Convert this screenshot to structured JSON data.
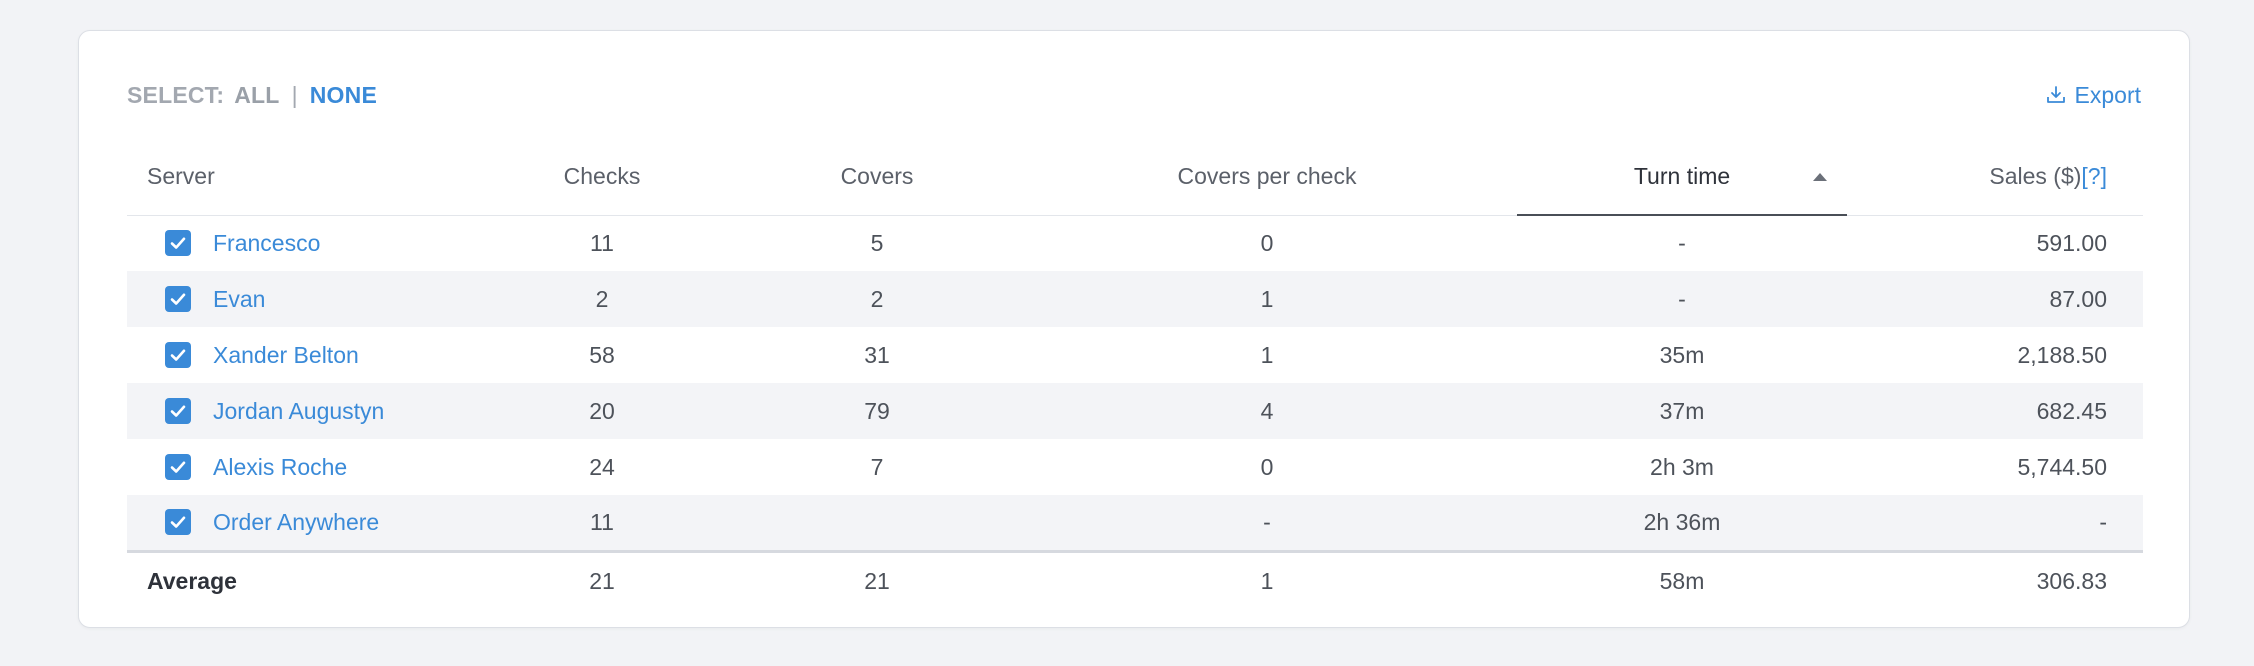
{
  "toolbar": {
    "select_label": "SELECT:",
    "all_label": "ALL",
    "separator": "|",
    "none_label": "NONE",
    "export_label": "Export",
    "export_icon": "download-icon"
  },
  "table": {
    "headers": {
      "server": "Server",
      "checks": "Checks",
      "covers": "Covers",
      "covers_per_check": "Covers per check",
      "turn_time": "Turn time",
      "sales": "Sales ($)",
      "sales_help": "[?]"
    },
    "sort": {
      "column": "turn_time",
      "direction": "ascending"
    },
    "rows": [
      {
        "server": "Francesco",
        "checked": true,
        "checks": "11",
        "covers": "5",
        "covers_per_check": "0",
        "turn_time": "-",
        "sales": "591.00"
      },
      {
        "server": "Evan",
        "checked": true,
        "checks": "2",
        "covers": "2",
        "covers_per_check": "1",
        "turn_time": "-",
        "sales": "87.00"
      },
      {
        "server": "Xander Belton",
        "checked": true,
        "checks": "58",
        "covers": "31",
        "covers_per_check": "1",
        "turn_time": "35m",
        "sales": "2,188.50"
      },
      {
        "server": "Jordan Augustyn",
        "checked": true,
        "checks": "20",
        "covers": "79",
        "covers_per_check": "4",
        "turn_time": "37m",
        "sales": "682.45"
      },
      {
        "server": "Alexis Roche",
        "checked": true,
        "checks": "24",
        "covers": "7",
        "covers_per_check": "0",
        "turn_time": "2h 3m",
        "sales": "5,744.50"
      },
      {
        "server": "Order Anywhere",
        "checked": true,
        "checks": "11",
        "covers": "",
        "covers_per_check": "-",
        "turn_time": "2h 36m",
        "sales": "-"
      }
    ],
    "footer": {
      "label": "Average",
      "checks": "21",
      "covers": "21",
      "covers_per_check": "1",
      "turn_time": "58m",
      "sales": "306.83"
    }
  },
  "colors": {
    "accent": "#3a8ad8",
    "background": "#f2f3f6",
    "row_stripe": "#f3f4f7"
  }
}
